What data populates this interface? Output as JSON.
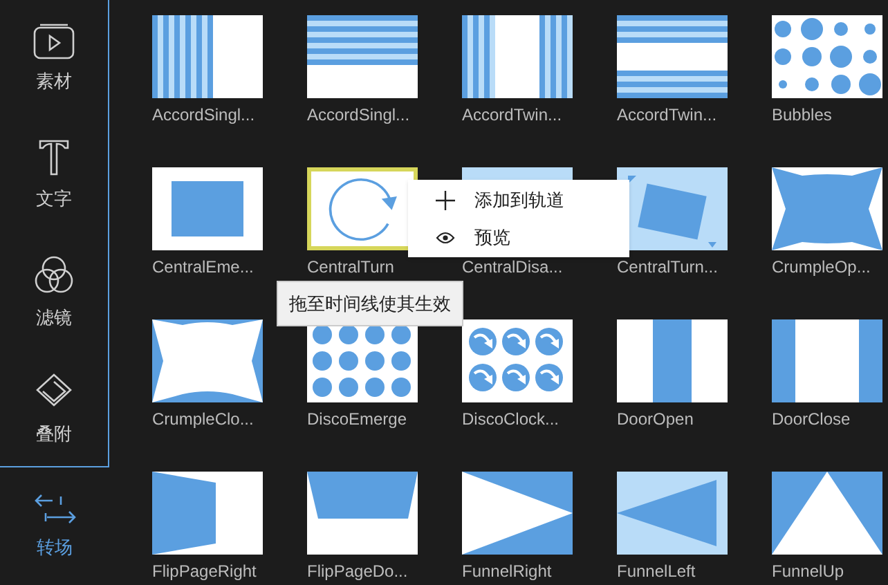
{
  "sidebar": {
    "items": [
      {
        "label": "素材",
        "selected": false
      },
      {
        "label": "文字",
        "selected": false
      },
      {
        "label": "滤镜",
        "selected": false
      },
      {
        "label": "叠附",
        "selected": false
      },
      {
        "label": "转场",
        "selected": true
      }
    ]
  },
  "transitions": [
    {
      "name": "AccordSingl...",
      "selected": false
    },
    {
      "name": "AccordSingl...",
      "selected": false
    },
    {
      "name": "AccordTwin...",
      "selected": false
    },
    {
      "name": "AccordTwin...",
      "selected": false
    },
    {
      "name": "Bubbles",
      "selected": false
    },
    {
      "name": "CentralEme...",
      "selected": false
    },
    {
      "name": "CentralTurn",
      "selected": true
    },
    {
      "name": "CentralDisa...",
      "selected": false
    },
    {
      "name": "CentralTurn...",
      "selected": false
    },
    {
      "name": "CrumpleOp...",
      "selected": false
    },
    {
      "name": "CrumpleClo...",
      "selected": false
    },
    {
      "name": "DiscoEmerge",
      "selected": false
    },
    {
      "name": "DiscoClock...",
      "selected": false
    },
    {
      "name": "DoorOpen",
      "selected": false
    },
    {
      "name": "DoorClose",
      "selected": false
    },
    {
      "name": "FlipPageRight",
      "selected": false
    },
    {
      "name": "FlipPageDo...",
      "selected": false
    },
    {
      "name": "FunnelRight",
      "selected": false
    },
    {
      "name": "FunnelLeft",
      "selected": false
    },
    {
      "name": "FunnelUp",
      "selected": false
    }
  ],
  "context_menu": {
    "items": [
      {
        "kind": "add",
        "label": "添加到轨道"
      },
      {
        "kind": "preview",
        "label": "预览"
      }
    ]
  },
  "tooltip": "拖至时间线使其生效"
}
